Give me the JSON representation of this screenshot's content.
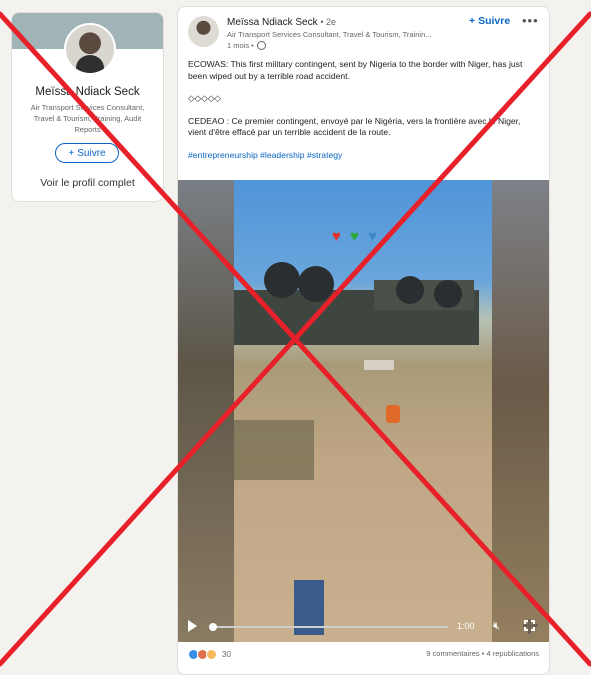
{
  "profile_card": {
    "name": "Meïssa Ndiack Seck",
    "headline": "Air Transport Services Consultant, Travel & Tourism, Training, Audit Reports",
    "follow_label": "Suivre",
    "view_profile_label": "Voir le profil complet"
  },
  "post": {
    "author_name": "Meïssa Ndiack Seck",
    "connection_degree": "• 2e",
    "author_headline": "Air Transport Services Consultant, Travel & Tourism, Trainin...",
    "time": "1 mois •",
    "follow_label": "Suivre",
    "text_en": "ECOWAS: This first military contingent, sent by Nigeria to the border with Niger, has just been wiped out by a terrible road accident.",
    "separator": "◇◇◇◇◇",
    "text_fr": "CEDEAO : Ce premier contingent, envoyé par le Nigéria, vers la frontière avec le Niger, vient d'être effacé par un terrible accident de la route.",
    "hashtags": "#entrepreneurship #leadership #strategy",
    "video": {
      "duration": "1:00"
    },
    "reaction_count": "30",
    "comments": "9 commentaires",
    "reposts": "4 republications"
  },
  "colors": {
    "accent": "#0a66c2",
    "cross": "#e8202a"
  },
  "icons": {
    "more": "more-dots-icon",
    "globe": "globe-icon",
    "play": "play-icon",
    "volume": "volume-muted-icon",
    "fullscreen": "fullscreen-icon"
  }
}
